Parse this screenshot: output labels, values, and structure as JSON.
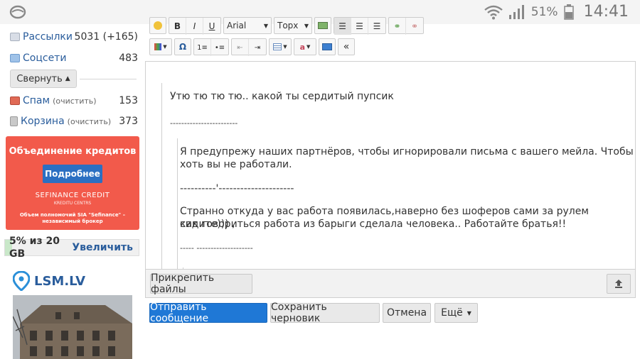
{
  "status_bar": {
    "battery": "51%",
    "time": "14:41"
  },
  "sidebar": {
    "folders": [
      {
        "name": "Рассылки",
        "sub": "",
        "count": "5031 (+165)"
      },
      {
        "name": "Соцсети",
        "sub": "",
        "count": "483"
      },
      {
        "name": "Спам",
        "sub": "(очистить)",
        "count": "153"
      },
      {
        "name": "Корзина",
        "sub": "(очистить)",
        "count": "373"
      }
    ],
    "collapse_label": "Свернуть",
    "ad": {
      "title": "Объединение кредитов",
      "button": "Подробнее",
      "brand": "SEFINANCE CREDIT",
      "brand_sub": "KREDITU CENTRS",
      "footer": "Объем полномочий SIA \"Sefinance\" – независимый брокер"
    },
    "quota": {
      "text": "5% из 20 GB",
      "action": "Увеличить",
      "used_percent": 5
    },
    "news_brand": "LSM.LV"
  },
  "toolbar": {
    "font": "Arial",
    "size": "Торх"
  },
  "editor": {
    "line1": "Утю тю тю тю.. какой ты сердитый пупсик",
    "sep1": "------------------------",
    "q1_line1": "Я предупрежу наших партнёров, чтобы игнорировали письма с вашего мейла. Чтобы",
    "q1_line2": "хоть вы не работали.",
    "sep2": "----------'---------------------",
    "q2_line1": "Странно откуда у вас работа появилась,наверно без шоферов сами за рулем сидите))) ,",
    "q2_line2": "как говориться работа из барыги сделала человека.. Работайте братья!!",
    "sep3": "----- --------------------"
  },
  "actions": {
    "attach": "Прикрепить файлы",
    "send": "Отправить сообщение",
    "save_draft": "Сохранить черновик",
    "cancel": "Отмена",
    "more": "Ещё"
  }
}
